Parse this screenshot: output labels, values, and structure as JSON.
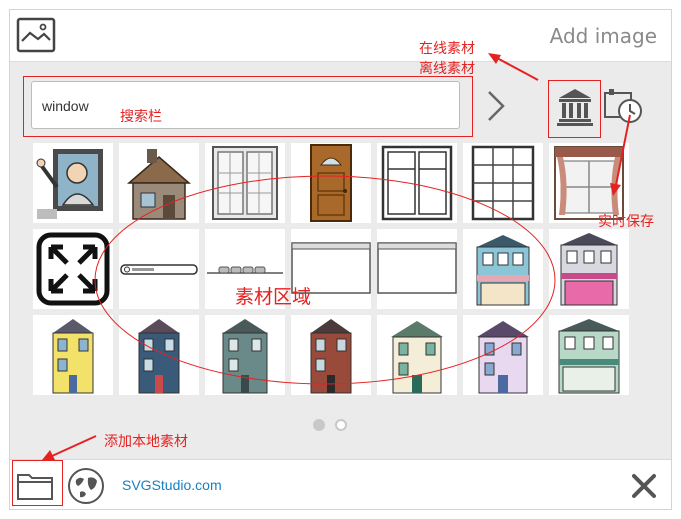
{
  "dialog": {
    "title": "Add image",
    "header_icon": "image-icon"
  },
  "search": {
    "value": "window",
    "next_icon": "chevron-right-icon",
    "library_icon": "library-icon",
    "history_icon": "history-clock-icon"
  },
  "library": {
    "tiles": [
      {
        "name": "man-in-window"
      },
      {
        "name": "cottage-window"
      },
      {
        "name": "white-double-window"
      },
      {
        "name": "wooden-door"
      },
      {
        "name": "french-window"
      },
      {
        "name": "sash-window"
      },
      {
        "name": "curtain-window"
      },
      {
        "name": "fullscreen-arrows"
      },
      {
        "name": "search-bar-widget"
      },
      {
        "name": "breadcrumb-widget"
      },
      {
        "name": "browser-window-frame"
      },
      {
        "name": "browser-window-frame-2"
      },
      {
        "name": "blue-shop-house"
      },
      {
        "name": "pink-shop-house"
      },
      {
        "name": "yellow-townhouse"
      },
      {
        "name": "cream-townhouse"
      },
      {
        "name": "teal-townhouse"
      },
      {
        "name": "red-brick-townhouse"
      },
      {
        "name": "green-trim-townhouse"
      },
      {
        "name": "lilac-townhouse"
      },
      {
        "name": "green-shop-house"
      }
    ],
    "pages": 2,
    "current_page": 1
  },
  "footer": {
    "folder_icon": "folder-icon",
    "globe_icon": "globe-icon",
    "brand": "SVGStudio.com",
    "close_icon": "close-icon"
  },
  "annotations": {
    "online_offline_line1": "在线素材",
    "online_offline_line2": "离线素材",
    "search_bar": "搜索栏",
    "autosave": "实时保存",
    "material_area": "素材区域",
    "add_local": "添加本地素材"
  },
  "colors": {
    "frame_bg": "#ebebeb",
    "annotation": "#e52222",
    "link": "#1a7ec2",
    "icon": "#555555"
  }
}
